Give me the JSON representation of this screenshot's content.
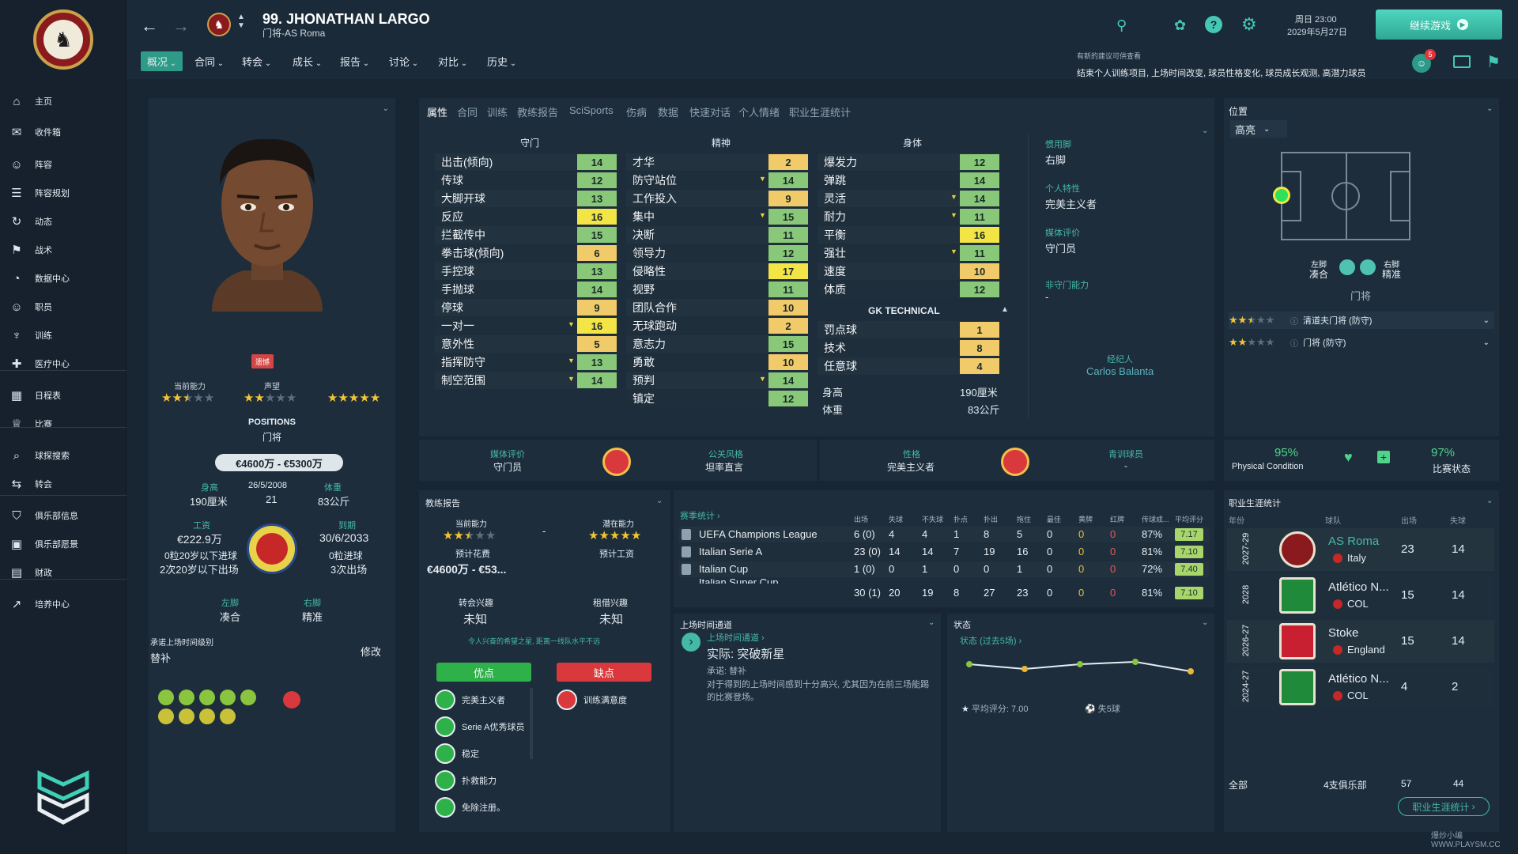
{
  "player": {
    "title": "99. JHONATHAN LARGO",
    "subtitle": "门将-AS Roma",
    "status_chip": "遗憾",
    "current_ability_label": "当前能力",
    "reputation_label": "声望",
    "potential_label": "潜在能力",
    "current_ability_stars": 2.5,
    "reputation_stars": 2,
    "potential_stars": 5,
    "positions_heading": "POSITIONS",
    "positions_value": "门将",
    "value_range": "€4600万 - €5300万",
    "height_label": "身高",
    "height": "190厘米",
    "dob": "26/5/2008",
    "age": "21",
    "weight_label": "体重",
    "weight": "83公斤",
    "wage_label": "工资",
    "wage": "€222.9万",
    "contract_label": "到期",
    "contract": "30/6/2033",
    "u21_goals": "0粒20岁以下进球",
    "u20_apps": "2次20岁以下出场",
    "intl_goals": "0粒进球",
    "intl_apps": "3次出场",
    "left_foot_label": "左脚",
    "left_foot": "凑合",
    "right_foot_label": "右脚",
    "right_foot": "精准",
    "promised_time_label": "承诺上场时间级别",
    "promised_time": "替补",
    "edit_label": "修改"
  },
  "topbar": {
    "date_day": "周日 23:00",
    "date": "2029年5月27日",
    "continue_button": "继续游戏",
    "notification_count": "5",
    "tip_heading": "有新的建议可供查看",
    "tip_text": "结束个人训练项目, 上场时间改变, 球员性格变化, 球员成长观测, 高潜力球员"
  },
  "menu": [
    "概况",
    "合同",
    "转会",
    "成长",
    "报告",
    "讨论",
    "对比",
    "历史"
  ],
  "sidebar": {
    "items": [
      "主页",
      "收件箱",
      "阵容",
      "阵容规划",
      "动态",
      "战术",
      "数据中心",
      "职员",
      "训练",
      "医疗中心",
      "日程表",
      "比赛",
      "球探搜索",
      "转会",
      "俱乐部信息",
      "俱乐部愿景",
      "财政",
      "培养中心"
    ]
  },
  "tabs": [
    "属性",
    "合同",
    "训练",
    "教练报告",
    "SciSports",
    "伤病",
    "数据",
    "快速对话",
    "个人情绪",
    "职业生涯统计"
  ],
  "attributes": {
    "gk_heading": "守门",
    "mental_heading": "精神",
    "physical_heading": "身体",
    "gk_technical_heading": "GK TECHNICAL",
    "goalkeeping": [
      {
        "name": "出击(倾向)",
        "value": "14"
      },
      {
        "name": "传球",
        "value": "12"
      },
      {
        "name": "大脚开球",
        "value": "13"
      },
      {
        "name": "反应",
        "value": "16"
      },
      {
        "name": "拦截传中",
        "value": "15"
      },
      {
        "name": "拳击球(倾向)",
        "value": "6"
      },
      {
        "name": "手控球",
        "value": "13"
      },
      {
        "name": "手抛球",
        "value": "14"
      },
      {
        "name": "停球",
        "value": "9"
      },
      {
        "name": "一对一",
        "value": "16"
      },
      {
        "name": "意外性",
        "value": "5"
      },
      {
        "name": "指挥防守",
        "value": "13"
      },
      {
        "name": "制空范围",
        "value": "14"
      }
    ],
    "mental": [
      {
        "name": "才华",
        "value": "2"
      },
      {
        "name": "防守站位",
        "value": "14"
      },
      {
        "name": "工作投入",
        "value": "9"
      },
      {
        "name": "集中",
        "value": "15"
      },
      {
        "name": "决断",
        "value": "11"
      },
      {
        "name": "领导力",
        "value": "12"
      },
      {
        "name": "侵略性",
        "value": "17"
      },
      {
        "name": "视野",
        "value": "11"
      },
      {
        "name": "团队合作",
        "value": "10"
      },
      {
        "name": "无球跑动",
        "value": "2"
      },
      {
        "name": "意志力",
        "value": "15"
      },
      {
        "name": "勇敢",
        "value": "10"
      },
      {
        "name": "预判",
        "value": "14"
      },
      {
        "name": "镇定",
        "value": "12"
      }
    ],
    "physical": [
      {
        "name": "爆发力",
        "value": "12"
      },
      {
        "name": "弹跳",
        "value": "14"
      },
      {
        "name": "灵活",
        "value": "14"
      },
      {
        "name": "耐力",
        "value": "11"
      },
      {
        "name": "平衡",
        "value": "16"
      },
      {
        "name": "强壮",
        "value": "11"
      },
      {
        "name": "速度",
        "value": "10"
      },
      {
        "name": "体质",
        "value": "12"
      }
    ],
    "gk_technical": [
      {
        "name": "罚点球",
        "value": "1"
      },
      {
        "name": "技术",
        "value": "8"
      },
      {
        "name": "任意球",
        "value": "4"
      }
    ],
    "height_label": "身高",
    "height_value": "190厘米",
    "weight_label": "体重",
    "weight_value": "83公斤"
  },
  "side_info": {
    "foot_label": "惯用脚",
    "foot_value": "右脚",
    "trait_label": "个人特性",
    "trait_value": "完美主义者",
    "media_label": "媒体评价",
    "media_value": "守门员",
    "non_player_label": "非守门能力",
    "non_player_value": "-",
    "agent_label": "经纪人",
    "agent_value": "Carlos Balanta"
  },
  "strip": {
    "media_label": "媒体评价",
    "media_value": "守门员",
    "pr_label": "公关风格",
    "pr_value": "坦率直言",
    "personality_label": "性格",
    "personality_value": "完美主义者",
    "youth_label": "青训球员",
    "youth_value": "-",
    "condition_value": "95%",
    "condition_label": "Physical Condition",
    "sharpness_value": "97%",
    "sharpness_label": "比赛状态"
  },
  "position": {
    "heading": "位置",
    "highlight": "高亮",
    "left_foot_label": "左脚",
    "left_foot": "凑合",
    "right_foot_label": "右脚",
    "right_foot": "精准",
    "role_label": "门将",
    "roles": [
      {
        "name": "清道夫门将 (防守)",
        "stars": 2.5
      },
      {
        "name": "门将 (防守)",
        "stars": 2
      }
    ]
  },
  "coach_report": {
    "heading": "教练报告",
    "current_label": "当前能力",
    "potential_label": "潜在能力",
    "current_stars": 2.5,
    "potential_stars": 5,
    "dash": "-",
    "fee_label": "预计花费",
    "fee_value": "€4600万 - €53...",
    "wage_label": "预计工资",
    "transfer_interest_label": "转会兴趣",
    "transfer_interest_value": "未知",
    "loan_interest_label": "租借兴趣",
    "loan_interest_value": "未知",
    "note": "令人兴奋的希望之星, 距离一线队水平不远",
    "pros_label": "优点",
    "cons_label": "缺点",
    "pros": [
      "完美主义者",
      "Serie A优秀球员",
      "稳定",
      "扑救能力",
      "免除注册。"
    ],
    "cons": [
      "训练满意度"
    ]
  },
  "season_stats": {
    "heading": "赛季统计",
    "columns": [
      "出场",
      "失球",
      "不失球",
      "扑点",
      "扑出",
      "拖住",
      "最佳",
      "黄牌",
      "红牌",
      "传球成...",
      "平均评分"
    ],
    "rows": [
      {
        "comp": "UEFA Champions League",
        "vals": [
          "6 (0)",
          "4",
          "4",
          "1",
          "8",
          "5",
          "0",
          "0",
          "0",
          "87%"
        ],
        "rating": "7.17"
      },
      {
        "comp": "Italian Serie A",
        "vals": [
          "23 (0)",
          "14",
          "14",
          "7",
          "19",
          "16",
          "0",
          "0",
          "0",
          "81%"
        ],
        "rating": "7.10"
      },
      {
        "comp": "Italian Cup",
        "vals": [
          "1 (0)",
          "0",
          "1",
          "0",
          "0",
          "1",
          "0",
          "0",
          "0",
          "72%"
        ],
        "rating": "7.40"
      }
    ],
    "partial_comp": "Italian Super Cup",
    "total": [
      "30 (1)",
      "20",
      "19",
      "8",
      "27",
      "23",
      "0",
      "0",
      "0",
      "81%"
    ],
    "total_rating": "7.10"
  },
  "playing_time": {
    "heading": "上场时间通道",
    "link": "上场时间通道",
    "actual": "实际: 突破新星",
    "promise": "承诺: 替补",
    "desc": "对于得到的上场时间感到十分高兴, 尤其因为在前三场能踢的比赛登场。"
  },
  "form": {
    "heading": "状态",
    "link": "状态 (过去5场)",
    "avg_label": "平均评分: 7.00",
    "conceded_label": "失5球",
    "ratings": [
      7.1,
      7.0,
      7.1,
      7.15,
      6.95
    ]
  },
  "career": {
    "heading": "职业生涯统计",
    "col_year": "年份",
    "col_club": "球队",
    "col_apps": "出场",
    "col_conceded": "失球",
    "rows": [
      {
        "year": "2027-29",
        "club": "AS Roma",
        "nation": "Italy",
        "apps": "23",
        "conceded": "14"
      },
      {
        "year": "2028",
        "club": "Atlético N...",
        "nation": "COL",
        "apps": "15",
        "conceded": "14"
      },
      {
        "year": "2026-27",
        "club": "Stoke",
        "nation": "England",
        "apps": "15",
        "conceded": "14"
      },
      {
        "year": "2024-27",
        "club": "Atlético N...",
        "nation": "COL",
        "apps": "4",
        "conceded": "2"
      }
    ],
    "total_label": "全部",
    "total_clubs": "4支俱乐部",
    "total_apps": "57",
    "total_conceded": "44",
    "button": "职业生涯统计"
  },
  "watermark": "爆炒小编 WWW.PLAYSM.CC"
}
